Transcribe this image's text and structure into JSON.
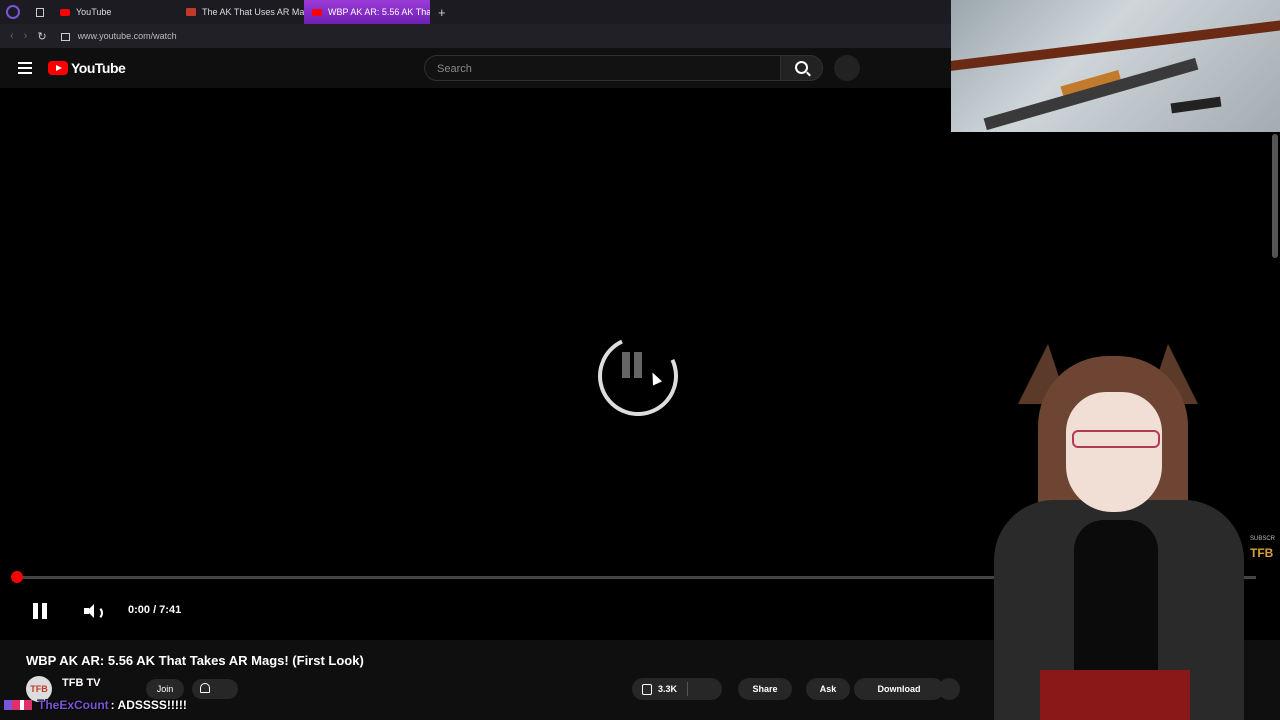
{
  "browser": {
    "tabs": [
      {
        "label": "YouTube",
        "icon": "youtube-icon"
      },
      {
        "label": "The AK That Uses AR Ma",
        "icon": "tfb-icon"
      },
      {
        "label": "WBP AK AR: 5.56 AK Tha",
        "icon": "youtube-icon",
        "active": true
      }
    ],
    "url": "www.youtube.com/watch"
  },
  "header": {
    "logo": "YouTube",
    "search_placeholder": "Search"
  },
  "player": {
    "time": "0:00 / 7:41",
    "progress_fraction": 0.0,
    "state": "buffering"
  },
  "video": {
    "title": "WBP AK AR: 5.56 AK That Takes AR Mags! (First Look)",
    "channel": "TFB TV",
    "channel_avatar_text": "TFB",
    "join_label": "Join",
    "like_count": "3.3K",
    "share_label": "Share",
    "ask_label": "Ask",
    "download_label": "Download"
  },
  "overlay": {
    "chat_user": "TheExCount",
    "chat_message": ": ADSSSS!!!!!",
    "watermark_top": "SUBSCR",
    "watermark_logo": "TFB"
  },
  "colors": {
    "accent": "#ff0000",
    "active_tab": "#8a2be2",
    "background": "#0f0f0f"
  }
}
